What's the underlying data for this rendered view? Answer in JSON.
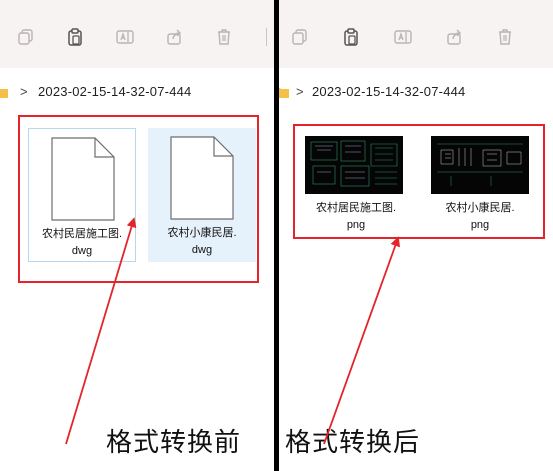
{
  "toolbar": {
    "buttons": [
      "copy-icon",
      "paste-icon",
      "rename-icon",
      "share-icon",
      "delete-icon"
    ]
  },
  "address": {
    "chevron": ">",
    "path": "2023-02-15-14-32-07-444"
  },
  "before": {
    "caption": "格式转换前",
    "files": [
      {
        "line1": "农村民居施工图.",
        "line2": "dwg"
      },
      {
        "line1": "农村小康民居.",
        "line2": "dwg"
      }
    ]
  },
  "after": {
    "caption": "格式转换后",
    "files": [
      {
        "line1": "农村居民施工图.",
        "line2": "png"
      },
      {
        "line1": "农村小康民居.",
        "line2": "png"
      }
    ]
  },
  "colors": {
    "annotation": "#e3242b",
    "toolbar_bg": "#f7f3f2",
    "folder": "#f4c04a",
    "divider": "#000000"
  }
}
